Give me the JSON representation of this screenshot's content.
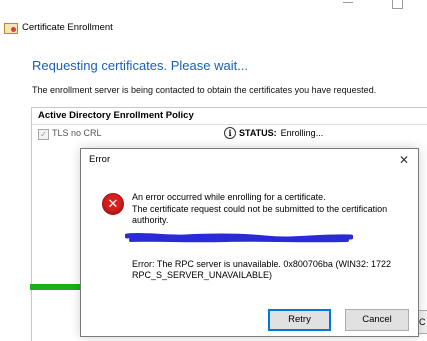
{
  "window": {
    "title": "Certificate Enrollment",
    "title_icon": "certificate-icon"
  },
  "main": {
    "heading": "Requesting certificates. Please wait...",
    "subtext": "The enrollment server is being contacted to obtain the certificates you have requested.",
    "policy": {
      "header": "Active Directory Enrollment Policy",
      "item_label": "TLS no CRL",
      "item_checked": true,
      "status_icon": "info-icon",
      "status_key": "STATUS:",
      "status_value": "Enrolling..."
    },
    "progress_fraction": 0.13,
    "progress_color": "#19b019",
    "partial_button_label": "C"
  },
  "dialog": {
    "title": "Error",
    "close_glyph": "✕",
    "icon": "error-icon",
    "message_main": "An error occurred while enrolling for a certificate.",
    "message_detail": "The certificate request could not be submitted to the certification authority.",
    "error_code": "Error: The RPC server is unavailable. 0x800706ba (WIN32: 1722 RPC_S_SERVER_UNAVAILABLE)",
    "retry_label": "Retry",
    "cancel_label": "Cancel"
  },
  "colors": {
    "heading": "#1b5fb5",
    "error_red": "#d81e1e",
    "redaction": "#2a2ad6"
  }
}
